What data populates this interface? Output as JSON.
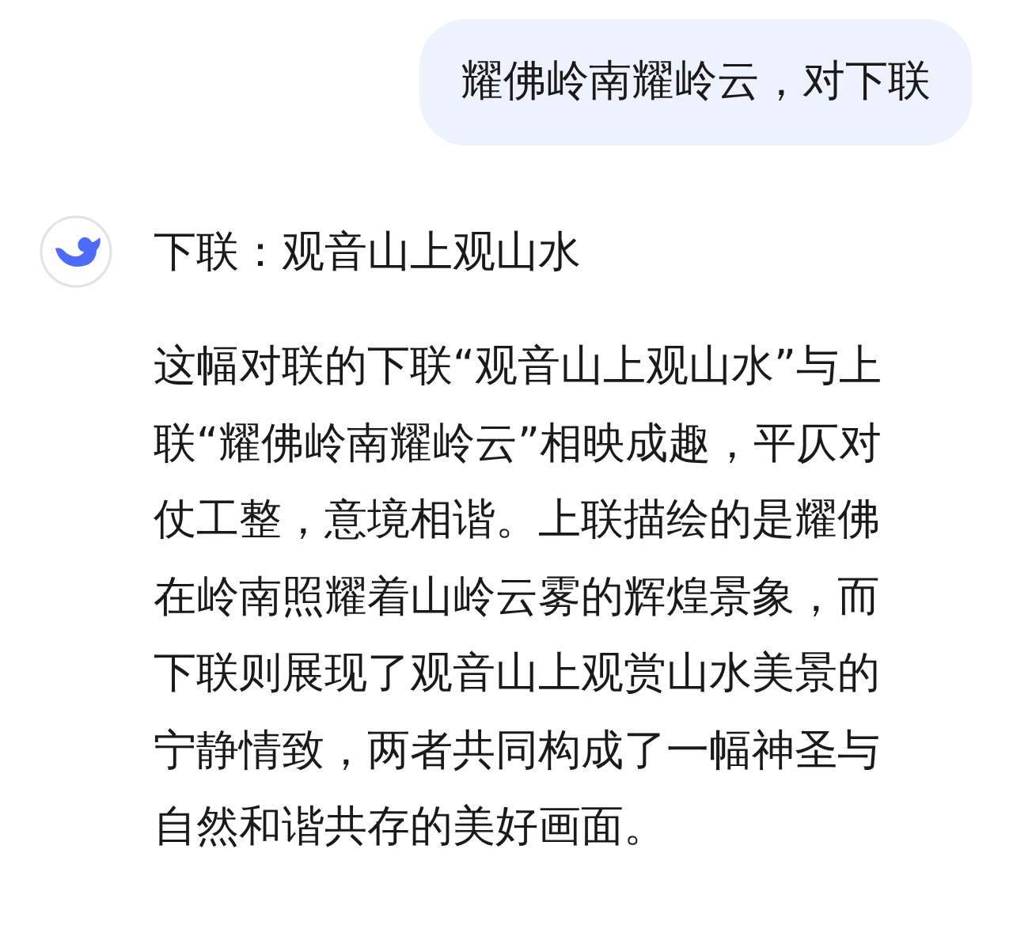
{
  "messages": [
    {
      "kind": "user",
      "text": "耀佛岭南耀岭云，对下联"
    },
    {
      "kind": "assistant",
      "title": "下联：观音山上观山水",
      "body": "这幅对联的下联“观音山上观山水”与上联“耀佛岭南耀岭云”相映成趣，平仄对仗工整，意境相谐。上联描绘的是耀佛在岭南照耀着山岭云雾的辉煌景象，而下联则展现了观音山上观赏山水美景的宁静情致，两者共同构成了一幅神圣与自然和谐共存的美好画面。"
    }
  ]
}
